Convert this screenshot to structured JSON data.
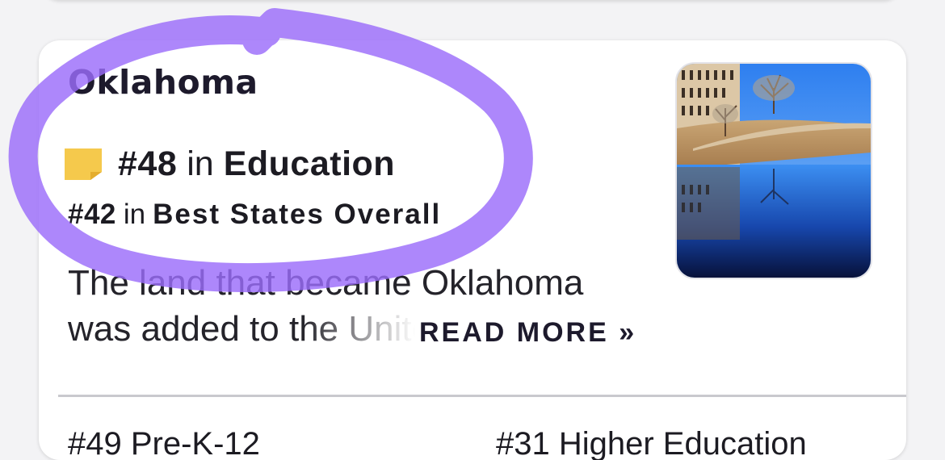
{
  "card": {
    "state_name": "Oklahoma",
    "primary_rank": {
      "number": "#48",
      "in": "in",
      "category": "Education"
    },
    "secondary_rank": {
      "number": "#42",
      "in": "in",
      "category": "Best States Overall"
    },
    "description": {
      "line1": "The land that became Oklahoma",
      "line2": "was added to the United S"
    },
    "read_more": "READ MORE »",
    "image": "oklahoma-city-memorial-reflecting-pool-photo"
  },
  "next_ranks": {
    "item1": "#49 Pre-K-12",
    "item2": "#31 Higher Education"
  },
  "colors": {
    "highlight": "#9b6dfa",
    "badge": "#f5c94c",
    "text": "#1d1a2c"
  }
}
